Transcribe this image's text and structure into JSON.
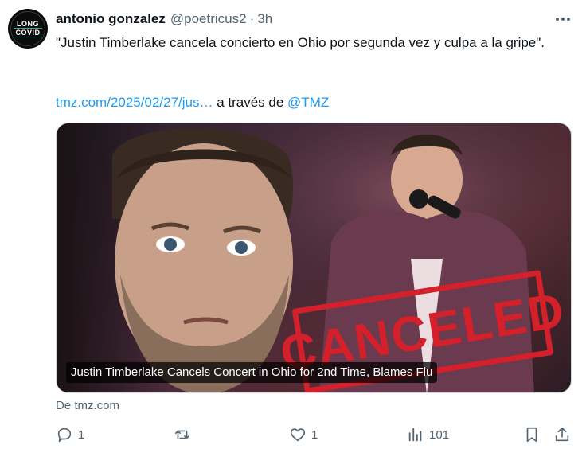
{
  "user": {
    "name": "antonio gonzalez",
    "handle": "@poetricus2",
    "separator": "·",
    "time": "3h",
    "avatar_line1": "LONG",
    "avatar_line2": "COVID"
  },
  "tweet": {
    "text": "\"Justin Timberlake cancela concierto en Ohio por segunda vez y culpa a la gripe\".",
    "link_text": "tmz.com/2025/02/27/jus…",
    "via_text": " a través de ",
    "mention": "@TMZ"
  },
  "card": {
    "caption": "Justin Timberlake Cancels Concert in Ohio for 2nd Time, Blames Flu",
    "stamp_text": "CANCELED",
    "source": "De tmz.com"
  },
  "actions": {
    "replies": "1",
    "retweets": "",
    "likes": "1",
    "views": "101"
  },
  "icons": [
    "more-icon",
    "reply-icon",
    "retweet-icon",
    "like-icon",
    "views-icon",
    "bookmark-icon",
    "share-icon"
  ],
  "colors": {
    "link": "#1d9bf0",
    "muted": "#536471",
    "text": "#0f1419",
    "stamp": "#d3202a"
  }
}
